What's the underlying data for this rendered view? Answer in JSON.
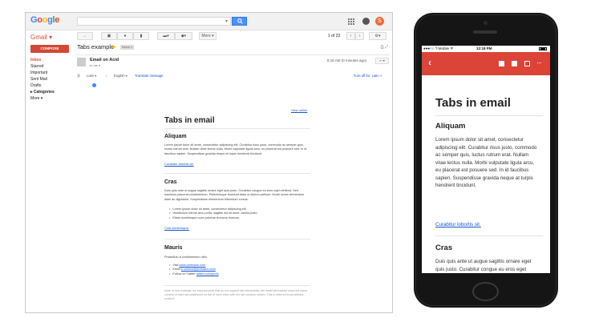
{
  "desktop": {
    "logo": [
      "G",
      "o",
      "o",
      "g",
      "l",
      "e"
    ],
    "gmail_label": "Gmail ▾",
    "compose_label": "COMPOSE",
    "nav": [
      "Inbox",
      "Starred",
      "Important",
      "Sent Mail",
      "Drafts",
      "▸ Categories",
      "More ▾"
    ],
    "toolbar": {
      "more_label": "More ▾",
      "pager": "1 of 23"
    },
    "subject": "Tabs example",
    "inbox_chip": "Inbox ×",
    "sender": {
      "name": "Email on Acid",
      "to": "to me ▾",
      "time": "8:15 AM (0 minutes ago)"
    },
    "translate": {
      "from": "Latin ▾",
      "arrow": "›",
      "to": "English ▾",
      "link": "Translate message",
      "turn_off": "Turn off for: Latin ×"
    },
    "email": {
      "view_online": "View online",
      "title": "Tabs in email",
      "sections": [
        {
          "heading": "Aliquam",
          "body": "Lorem ipsum dolor sit amet, consectetur adipiscing elit. Curabitur risus justo, commodo ac semper quis, luctus rutrum erat. Nullam vitae lectus nulla. Morbi vulputate ligula arcu, eu placerat est posuere sed. In id faucibus sapien. Suspendisse gravida neque at turpis hendrerit tincidunt.",
          "link": "Curabitur lobortis sit."
        },
        {
          "heading": "Cras",
          "body": "Duis quis ante ut augue sagittis ornare eget quis justo. Curabitur congue eu eros eget eleifend. Sed maximus placerat condimentum. Pellentesque tincidunt diam ut dictum pretium. Morbi luctus fermentum diam ac dignissim. Suspendisse elementum bibendum cursus.",
          "bullets": [
            "Lorem ipsum dolor sit amet, consectetur adipiscing elit.",
            "Vestibulum rutrum arcu porta, sagittis est sit amet, lacinia justo.",
            "Etiam scelerisque nunc pulvinar rhoncus rhoncus."
          ],
          "link": "Cras scelerisque."
        },
        {
          "heading": "Mauris",
          "body": "Phasellus ut condimentum nibh.",
          "contact": {
            "visit_prefix": "Visit ",
            "visit_link": "www.profusion.com",
            "email_prefix": "Email ",
            "email_link": "b.cumice@profusion.com",
            "twitter_prefix": "Follow on Twitter ",
            "twitter_link": "twitter.com/profu"
          }
        }
      ],
      "note": "Note: in this example, for environments that do not support tab interactivity, the email will instead show the same content of each tab positioned on top of each other with the tab controls hidden. This is referred to as fallback content."
    }
  },
  "phone": {
    "status": {
      "carrier": "●●●○○ T-Mobile ᯤ",
      "time": "12:18 PM"
    },
    "title": "Tabs in email",
    "sections": [
      {
        "heading": "Aliquam",
        "body": "Lorem ipsum dolor sit amet, consectetur adipiscing elit. Curabitur risus justo, commodo ac semper quis, luctus rutrum erat. Nullam vitae lectus nulla. Morbi vulputate ligula arcu, eu placerat est posuere sed. In id faucibus sapien. Suspendisse gravida neque at turpis hendrerit tincidunt.",
        "link": "Curabitur lobortis sit."
      },
      {
        "heading": "Cras",
        "body": "Duis quis ante ut augue sagittis ornare eget quis justo. Curabitur congue eu eros eget eleifend. Sed maximus placerat condimentum. Pellentesque tincidunt diam ut dictum pretium. Morbi luctus fermentum diam ac dignissim. Suspendisse"
      }
    ]
  },
  "colors": {
    "gmail_red": "#db4437",
    "compose_red": "#d14836",
    "link_blue": "#1155cc",
    "search_blue": "#4d90fe"
  }
}
